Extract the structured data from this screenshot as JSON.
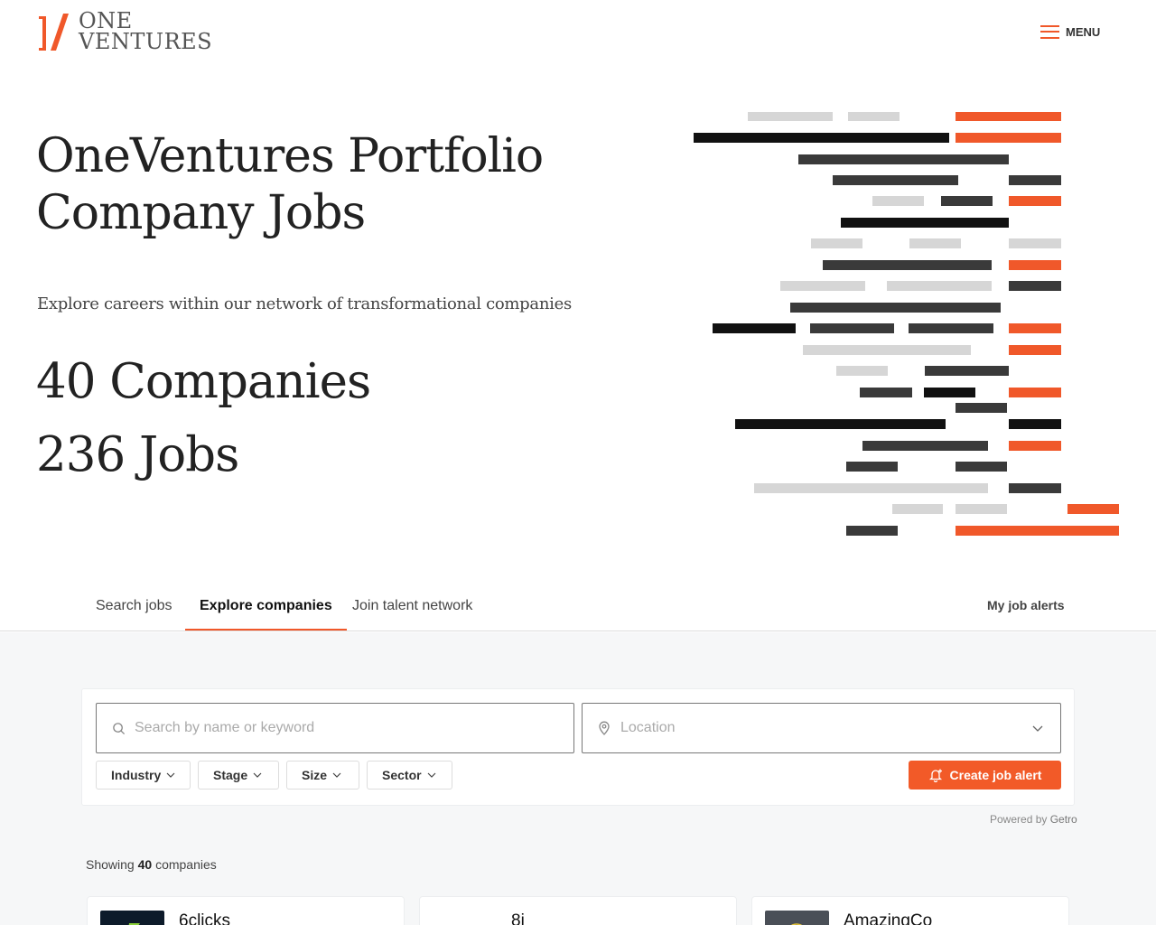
{
  "header": {
    "logo_mark": "1/",
    "logo_line1": "ONE",
    "logo_line2": "VENTURES",
    "menu_label": "MENU",
    "accent_color": "#f0582a"
  },
  "hero": {
    "title_line1": "OneVentures Portfolio",
    "title_line2": "Company Jobs",
    "subtitle": "Explore careers within our network of transformational companies",
    "companies_stat": "40 Companies",
    "jobs_stat": "236 Jobs"
  },
  "tabs": {
    "items": [
      {
        "label": "Search jobs",
        "active": false
      },
      {
        "label": "Explore companies",
        "active": true
      },
      {
        "label": "Join talent network",
        "active": false
      }
    ],
    "alerts_label": "My job alerts"
  },
  "search": {
    "keyword_placeholder": "Search by name or keyword",
    "location_placeholder": "Location",
    "filters": [
      "Industry",
      "Stage",
      "Size",
      "Sector"
    ],
    "create_alert_label": "Create job alert"
  },
  "powered_by": {
    "prefix": "Powered by",
    "brand": "Getro"
  },
  "results": {
    "prefix": "Showing",
    "count": "40",
    "suffix": "companies"
  },
  "companies": [
    {
      "name": "6clicks",
      "logo_color": "#0d1b2a"
    },
    {
      "name": "8i",
      "logo_color": "#ffffff"
    },
    {
      "name": "AmazingCo",
      "logo_color": "#4a4f57"
    }
  ],
  "icons": {
    "menu": "hamburger-icon",
    "search": "search-icon",
    "location": "location-pin-icon",
    "dropdown": "chevron-down-icon",
    "alert": "bell-icon"
  }
}
